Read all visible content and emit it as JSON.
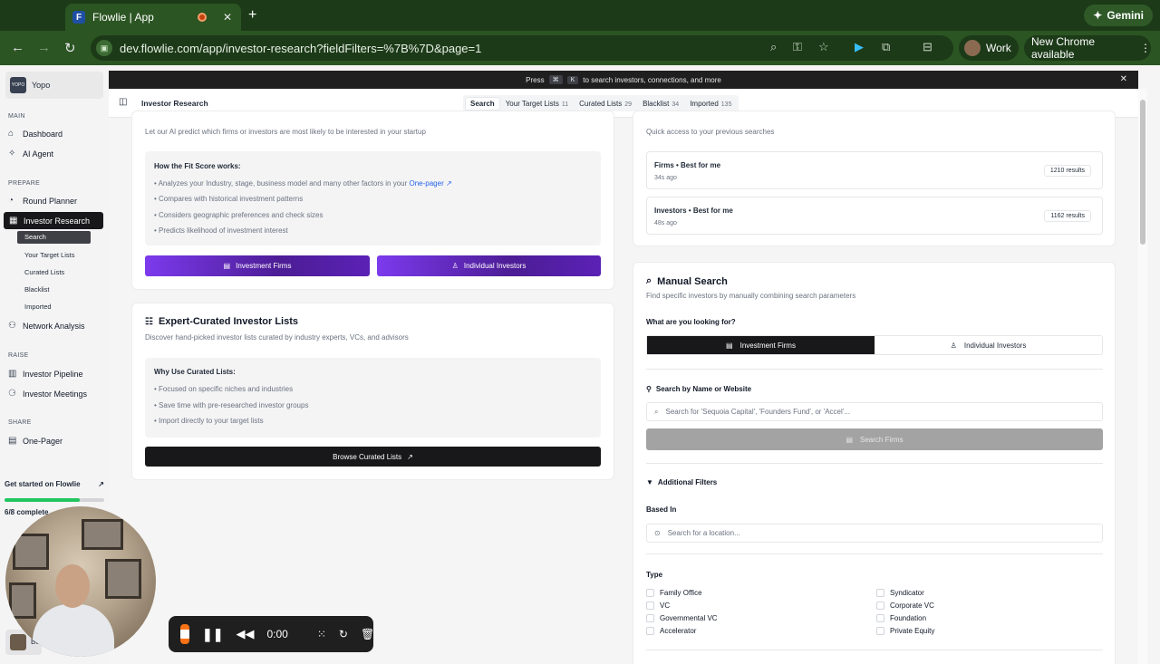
{
  "browser": {
    "tab_title": "Flowlie | App",
    "tab_favicon_letter": "F",
    "url": "dev.flowlie.com/app/investor-research?fieldFilters=%7B%7D&page=1",
    "profile_label": "Work",
    "update_label": "New Chrome available",
    "gemini_label": "Gemini"
  },
  "sidebar": {
    "workspace": "Yopo",
    "workspace_logo": "YOPO",
    "sections": {
      "main": "MAIN",
      "prepare": "PREPARE",
      "raise": "RAISE",
      "share": "SHARE"
    },
    "items": {
      "dashboard": "Dashboard",
      "ai_agent": "AI Agent",
      "round_planner": "Round Planner",
      "investor_research": "Investor Research",
      "network_analysis": "Network Analysis",
      "investor_pipeline": "Investor Pipeline",
      "investor_meetings": "Investor Meetings",
      "one_pager": "One-Pager"
    },
    "sub_items": [
      "Search",
      "Your Target Lists",
      "Curated Lists",
      "Blacklist",
      "Imported"
    ],
    "get_started": "Get started on Flowlie",
    "progress_text": "6/8 complete",
    "progress_fraction": 0.75,
    "user_initials": "Bo"
  },
  "recorder": {
    "time": "0:00"
  },
  "banner": {
    "pre": "Press",
    "key1": "⌘",
    "key2": "K",
    "post": "to search investors, connections, and more"
  },
  "header": {
    "title": "Investor Research",
    "tabs": [
      {
        "label": "Search",
        "count": ""
      },
      {
        "label": "Your Target Lists",
        "count": "11"
      },
      {
        "label": "Curated Lists",
        "count": "29"
      },
      {
        "label": "Blacklist",
        "count": "34"
      },
      {
        "label": "Imported",
        "count": "135"
      }
    ]
  },
  "ai_card": {
    "subtitle": "Let our AI predict which firms or investors are most likely to be interested in your startup",
    "how_title": "How the Fit Score works:",
    "bullet1_pre": "Analyzes your Industry, stage, business model and many other factors in your",
    "bullet1_link": "One-pager",
    "bullets": [
      "Compares with historical investment patterns",
      "Considers geographic preferences and check sizes",
      "Predicts likelihood of investment interest"
    ],
    "btn_firms": "Investment Firms",
    "btn_investors": "Individual Investors"
  },
  "curated_card": {
    "title": "Expert-Curated Investor Lists",
    "subtitle": "Discover hand-picked investor lists curated by industry experts, VCs, and advisors",
    "why_title": "Why Use Curated Lists:",
    "bullets": [
      "Focused on specific niches and industries",
      "Save time with pre-researched investor groups",
      "Import directly to your target lists"
    ],
    "browse": "Browse Curated Lists"
  },
  "recent_card": {
    "subtitle": "Quick access to your previous searches",
    "items": [
      {
        "title": "Firms • Best for me",
        "time": "34s ago",
        "results": "1210 results"
      },
      {
        "title": "Investors • Best for me",
        "time": "48s ago",
        "results": "1162 results"
      }
    ]
  },
  "manual_card": {
    "title": "Manual Search",
    "subtitle": "Find specific investors by manually combining search parameters",
    "looking_for": "What are you looking for?",
    "seg_firms": "Investment Firms",
    "seg_investors": "Individual Investors",
    "search_label": "Search by Name or Website",
    "search_placeholder": "Search for 'Sequoia Capital', 'Founders Fund', or 'Accel'...",
    "search_btn": "Search Firms",
    "filters_label": "Additional Filters",
    "based_in": "Based In",
    "location_placeholder": "Search for a location...",
    "type_label": "Type",
    "types_left": [
      "Family Office",
      "VC",
      "Governmental VC",
      "Accelerator"
    ],
    "types_right": [
      "Syndicator",
      "Corporate VC",
      "Foundation",
      "Private Equity"
    ]
  }
}
